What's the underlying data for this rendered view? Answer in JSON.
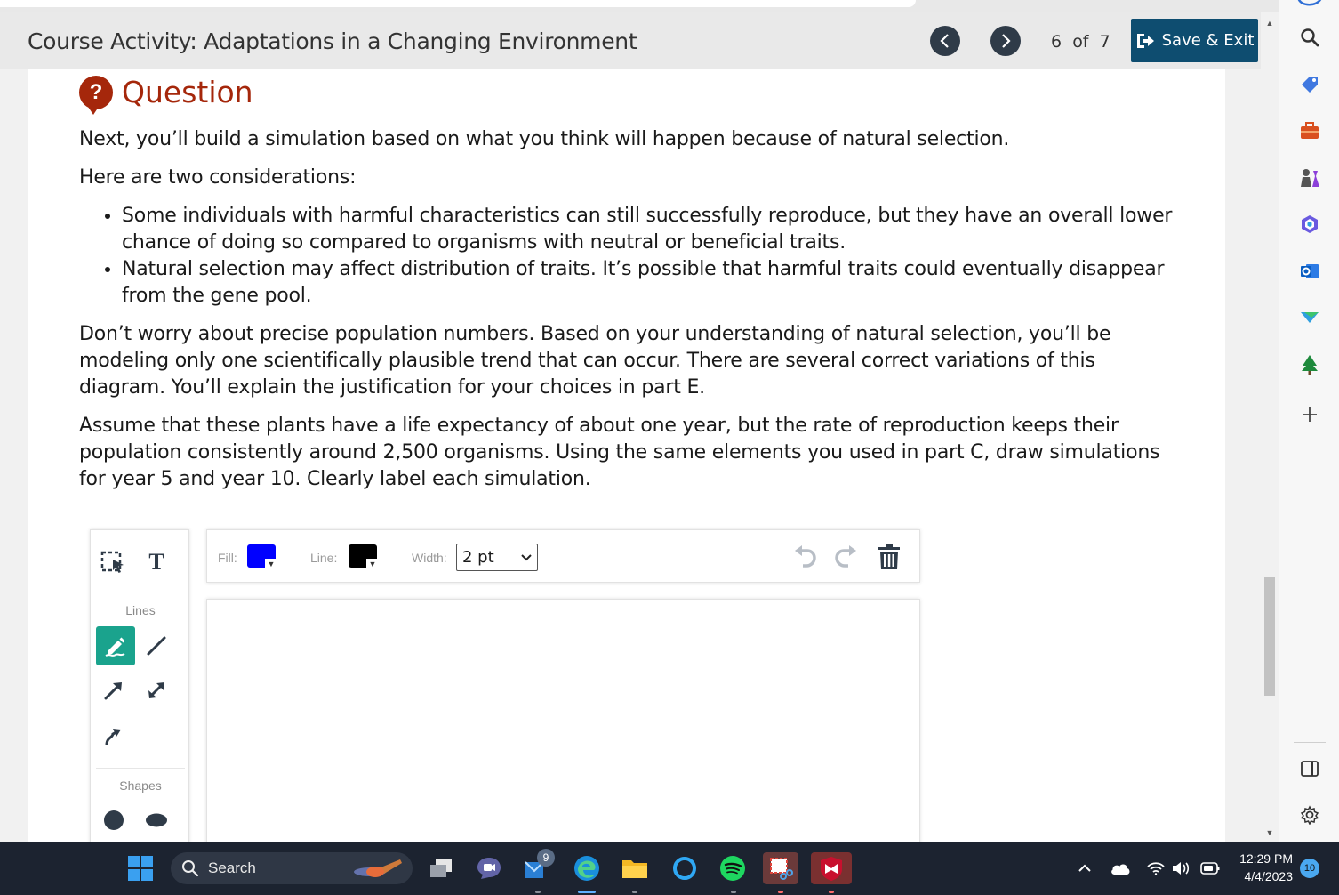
{
  "header": {
    "title": "Course Activity: Adaptations in a Changing Environment",
    "page_current": "6",
    "page_of": "of",
    "page_total": "7",
    "save_exit_label": "Save & Exit"
  },
  "question": {
    "icon_glyph": "?",
    "heading": "Question",
    "intro": "Next, you’ll build a simulation based on what you think will happen because of natural selection.",
    "considerations_lead": "Here are two considerations:",
    "bullets": [
      "Some individuals with harmful characteristics can still successfully reproduce, but they have an overall lower chance of doing so compared to organisms with neutral or beneficial traits.",
      "Natural selection may affect distribution of traits. It’s possible that harmful traits could eventually disappear from the gene pool."
    ],
    "para_trend": "Don’t worry about precise population numbers. Based on your understanding of natural selection, you’ll be modeling only one scientifically plausible trend that can occur. There are several correct variations of this diagram. You’ll explain the justification for your choices in part E.",
    "para_assume": "Assume that these plants have a life expectancy of about one year, but the rate of reproduction keeps their population consistently around 2,500 organisms. Using the same elements you used in part C, draw simulations for year 5 and year 10. Clearly label each simulation."
  },
  "toolbox": {
    "text_tool_glyph": "T",
    "lines_label": "Lines",
    "shapes_label": "Shapes"
  },
  "props": {
    "fill_label": "Fill:",
    "fill_color": "#0000ff",
    "line_label": "Line:",
    "line_color": "#000000",
    "width_label": "Width:",
    "width_value": "2 pt"
  },
  "taskbar": {
    "search_label": "Search",
    "mail_badge": "9",
    "time": "12:29 PM",
    "date": "4/4/2023",
    "notification_count": "10"
  },
  "colors": {
    "accent_dark": "#0e4d70",
    "question_red": "#a5270b",
    "tool_active": "#1aa38d",
    "nav_dark": "#2f3b48"
  }
}
